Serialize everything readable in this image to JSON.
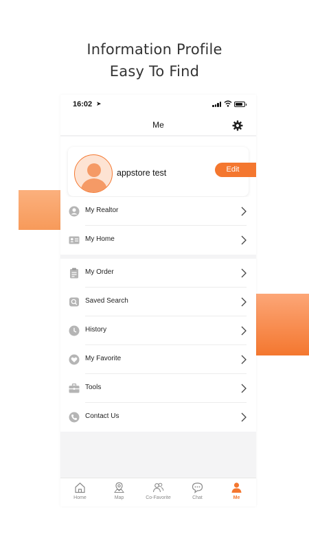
{
  "headline": {
    "line1": "Information Profile",
    "line2": "Easy To Find"
  },
  "status_bar": {
    "time": "16:02"
  },
  "nav": {
    "title": "Me",
    "settings_icon": "gear-icon"
  },
  "profile": {
    "username": "appstore test",
    "edit_label": "Edit"
  },
  "menu_group_1": [
    {
      "label": "My Realtor",
      "icon": "person-circle-icon"
    },
    {
      "label": "My Home",
      "icon": "id-card-icon"
    }
  ],
  "menu_group_2": [
    {
      "label": "My Order",
      "icon": "clipboard-icon"
    },
    {
      "label": "Saved Search",
      "icon": "saved-search-icon"
    },
    {
      "label": "History",
      "icon": "clock-icon"
    },
    {
      "label": "My Favorite",
      "icon": "heart-icon"
    },
    {
      "label": "Tools",
      "icon": "toolbox-icon"
    },
    {
      "label": "Contact Us",
      "icon": "phone-icon"
    }
  ],
  "tabs": [
    {
      "label": "Home",
      "icon": "home-icon"
    },
    {
      "label": "Map",
      "icon": "map-pin-icon"
    },
    {
      "label": "Co-Favorite",
      "icon": "users-icon"
    },
    {
      "label": "Chat",
      "icon": "chat-icon"
    },
    {
      "label": "Me",
      "icon": "person-icon",
      "active": true
    }
  ],
  "colors": {
    "accent": "#f4772f",
    "icon_gray": "#b5b5b5",
    "background": "#f4f4f5"
  }
}
